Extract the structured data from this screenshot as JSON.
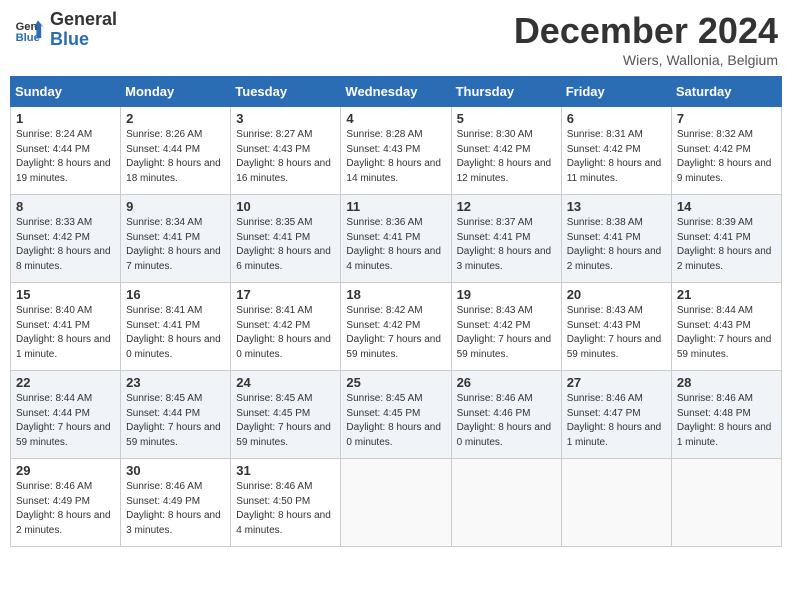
{
  "logo": {
    "general": "General",
    "blue": "Blue"
  },
  "title": {
    "month_year": "December 2024",
    "location": "Wiers, Wallonia, Belgium"
  },
  "days_of_week": [
    "Sunday",
    "Monday",
    "Tuesday",
    "Wednesday",
    "Thursday",
    "Friday",
    "Saturday"
  ],
  "weeks": [
    [
      {
        "day": 1,
        "sunrise": "8:24 AM",
        "sunset": "4:44 PM",
        "daylight": "8 hours and 19 minutes."
      },
      {
        "day": 2,
        "sunrise": "8:26 AM",
        "sunset": "4:44 PM",
        "daylight": "8 hours and 18 minutes."
      },
      {
        "day": 3,
        "sunrise": "8:27 AM",
        "sunset": "4:43 PM",
        "daylight": "8 hours and 16 minutes."
      },
      {
        "day": 4,
        "sunrise": "8:28 AM",
        "sunset": "4:43 PM",
        "daylight": "8 hours and 14 minutes."
      },
      {
        "day": 5,
        "sunrise": "8:30 AM",
        "sunset": "4:42 PM",
        "daylight": "8 hours and 12 minutes."
      },
      {
        "day": 6,
        "sunrise": "8:31 AM",
        "sunset": "4:42 PM",
        "daylight": "8 hours and 11 minutes."
      },
      {
        "day": 7,
        "sunrise": "8:32 AM",
        "sunset": "4:42 PM",
        "daylight": "8 hours and 9 minutes."
      }
    ],
    [
      {
        "day": 8,
        "sunrise": "8:33 AM",
        "sunset": "4:42 PM",
        "daylight": "8 hours and 8 minutes."
      },
      {
        "day": 9,
        "sunrise": "8:34 AM",
        "sunset": "4:41 PM",
        "daylight": "8 hours and 7 minutes."
      },
      {
        "day": 10,
        "sunrise": "8:35 AM",
        "sunset": "4:41 PM",
        "daylight": "8 hours and 6 minutes."
      },
      {
        "day": 11,
        "sunrise": "8:36 AM",
        "sunset": "4:41 PM",
        "daylight": "8 hours and 4 minutes."
      },
      {
        "day": 12,
        "sunrise": "8:37 AM",
        "sunset": "4:41 PM",
        "daylight": "8 hours and 3 minutes."
      },
      {
        "day": 13,
        "sunrise": "8:38 AM",
        "sunset": "4:41 PM",
        "daylight": "8 hours and 2 minutes."
      },
      {
        "day": 14,
        "sunrise": "8:39 AM",
        "sunset": "4:41 PM",
        "daylight": "8 hours and 2 minutes."
      }
    ],
    [
      {
        "day": 15,
        "sunrise": "8:40 AM",
        "sunset": "4:41 PM",
        "daylight": "8 hours and 1 minute."
      },
      {
        "day": 16,
        "sunrise": "8:41 AM",
        "sunset": "4:41 PM",
        "daylight": "8 hours and 0 minutes."
      },
      {
        "day": 17,
        "sunrise": "8:41 AM",
        "sunset": "4:42 PM",
        "daylight": "8 hours and 0 minutes."
      },
      {
        "day": 18,
        "sunrise": "8:42 AM",
        "sunset": "4:42 PM",
        "daylight": "7 hours and 59 minutes."
      },
      {
        "day": 19,
        "sunrise": "8:43 AM",
        "sunset": "4:42 PM",
        "daylight": "7 hours and 59 minutes."
      },
      {
        "day": 20,
        "sunrise": "8:43 AM",
        "sunset": "4:43 PM",
        "daylight": "7 hours and 59 minutes."
      },
      {
        "day": 21,
        "sunrise": "8:44 AM",
        "sunset": "4:43 PM",
        "daylight": "7 hours and 59 minutes."
      }
    ],
    [
      {
        "day": 22,
        "sunrise": "8:44 AM",
        "sunset": "4:44 PM",
        "daylight": "7 hours and 59 minutes."
      },
      {
        "day": 23,
        "sunrise": "8:45 AM",
        "sunset": "4:44 PM",
        "daylight": "7 hours and 59 minutes."
      },
      {
        "day": 24,
        "sunrise": "8:45 AM",
        "sunset": "4:45 PM",
        "daylight": "7 hours and 59 minutes."
      },
      {
        "day": 25,
        "sunrise": "8:45 AM",
        "sunset": "4:45 PM",
        "daylight": "8 hours and 0 minutes."
      },
      {
        "day": 26,
        "sunrise": "8:46 AM",
        "sunset": "4:46 PM",
        "daylight": "8 hours and 0 minutes."
      },
      {
        "day": 27,
        "sunrise": "8:46 AM",
        "sunset": "4:47 PM",
        "daylight": "8 hours and 1 minute."
      },
      {
        "day": 28,
        "sunrise": "8:46 AM",
        "sunset": "4:48 PM",
        "daylight": "8 hours and 1 minute."
      }
    ],
    [
      {
        "day": 29,
        "sunrise": "8:46 AM",
        "sunset": "4:49 PM",
        "daylight": "8 hours and 2 minutes."
      },
      {
        "day": 30,
        "sunrise": "8:46 AM",
        "sunset": "4:49 PM",
        "daylight": "8 hours and 3 minutes."
      },
      {
        "day": 31,
        "sunrise": "8:46 AM",
        "sunset": "4:50 PM",
        "daylight": "8 hours and 4 minutes."
      },
      null,
      null,
      null,
      null
    ]
  ]
}
